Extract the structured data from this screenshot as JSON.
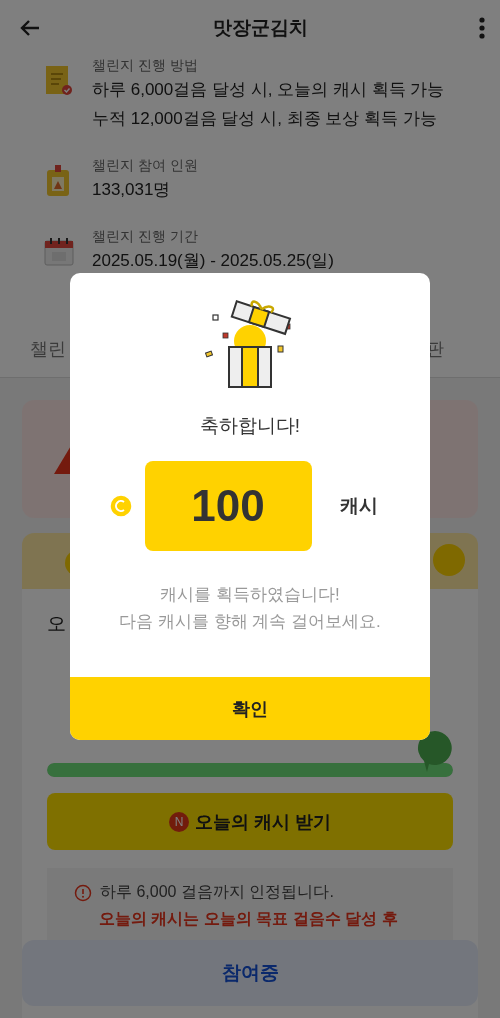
{
  "header": {
    "title": "맛장군김치"
  },
  "info": [
    {
      "kind": "method",
      "label": "챌린지 진행 방법",
      "lines": [
        "하루 6,000걸음 달성 시, 오늘의 캐시 획득 가능",
        "누적 12,000걸음 달성 시, 최종 보상 획득 가능"
      ]
    },
    {
      "kind": "participants",
      "label": "챌린지 참여 인원",
      "lines": [
        "133,031명"
      ]
    },
    {
      "kind": "period",
      "label": "챌린지 진행 기간",
      "lines": [
        "2025.05.19(월) - 2025.05.25(일)"
      ]
    }
  ],
  "tabs": [
    {
      "label": "챌린"
    },
    {
      "label": "판"
    }
  ],
  "today_card": {
    "title": "오",
    "progress": {
      "level": 1
    }
  },
  "claim_button": {
    "badge": "N",
    "label": "오늘의 캐시 받기"
  },
  "notice": {
    "text": "하루 6,000 걸음까지 인정됩니다.",
    "warning": "오늘의 캐시는 오늘의 목표 걸음수 달성 후"
  },
  "join_button": {
    "label": "참여중"
  },
  "dialog": {
    "title": "축하합니다!",
    "amount": "100",
    "unit": "캐시",
    "message": [
      "캐시를 획득하였습니다!",
      "다음 캐시를 향해 계속 걸어보세요."
    ],
    "confirm": "확인"
  }
}
